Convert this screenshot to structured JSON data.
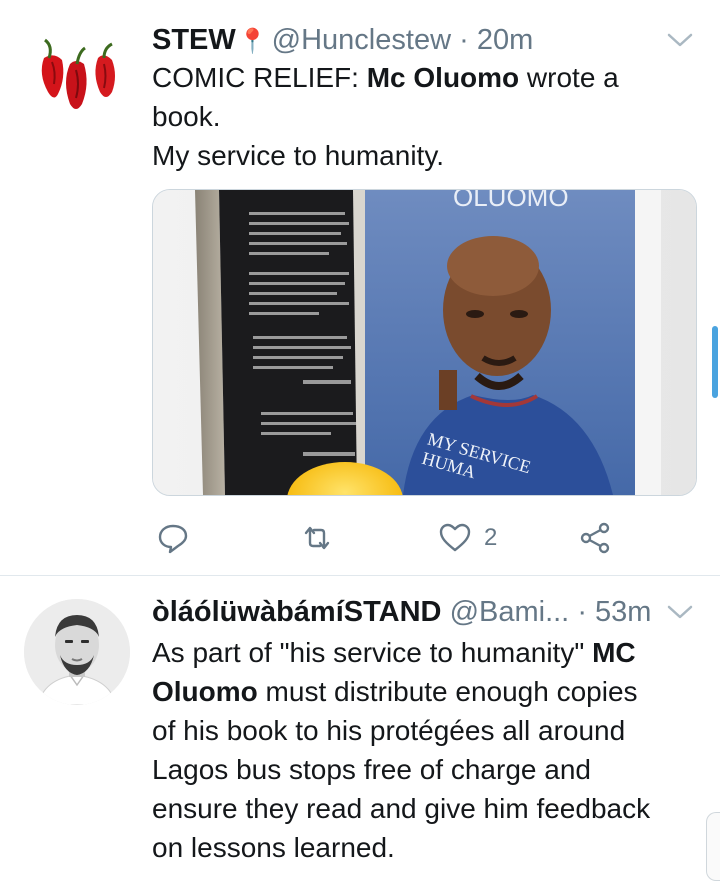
{
  "tweets": [
    {
      "name": "STEW",
      "handle": "@Hunclestew",
      "separator": "·",
      "time": "20m",
      "lines": [
        {
          "a": "COMIC RELIEF: ",
          "b": "Mc Oluomo",
          "c": " wrote a"
        },
        {
          "a": "book."
        },
        {
          "a": "My service to humanity."
        }
      ],
      "media": {
        "cover_top_text": "OLUOMO",
        "cover_title_line1": "MY SERVICE",
        "cover_title_line2": "HUMA"
      },
      "actions": {
        "reply_count": "",
        "retweet_count": "",
        "like_count": "2"
      }
    },
    {
      "name": "òláólüwàbámíSTAND",
      "handle": "@Bami...",
      "separator": "·",
      "time": "53m",
      "lines": [
        {
          "a": "As part of \"his service to humanity\" ",
          "b": "MC"
        },
        {
          "b": "Oluomo",
          "c": " must distribute enough copies"
        },
        {
          "a": "of his book to his protégées all around"
        },
        {
          "a": "Lagos bus stops free of charge and"
        },
        {
          "a": "ensure they read and give him feedback"
        },
        {
          "a": "on lessons learned."
        }
      ]
    }
  ],
  "icons": {
    "pin": "📍",
    "chevron": "chevron-down-icon",
    "reply": "reply-icon",
    "retweet": "retweet-icon",
    "like": "heart-icon",
    "share": "share-icon"
  },
  "colors": {
    "text": "#14171a",
    "secondary": "#657786",
    "divider": "#e1e8ed",
    "accent": "#4aa3df"
  }
}
